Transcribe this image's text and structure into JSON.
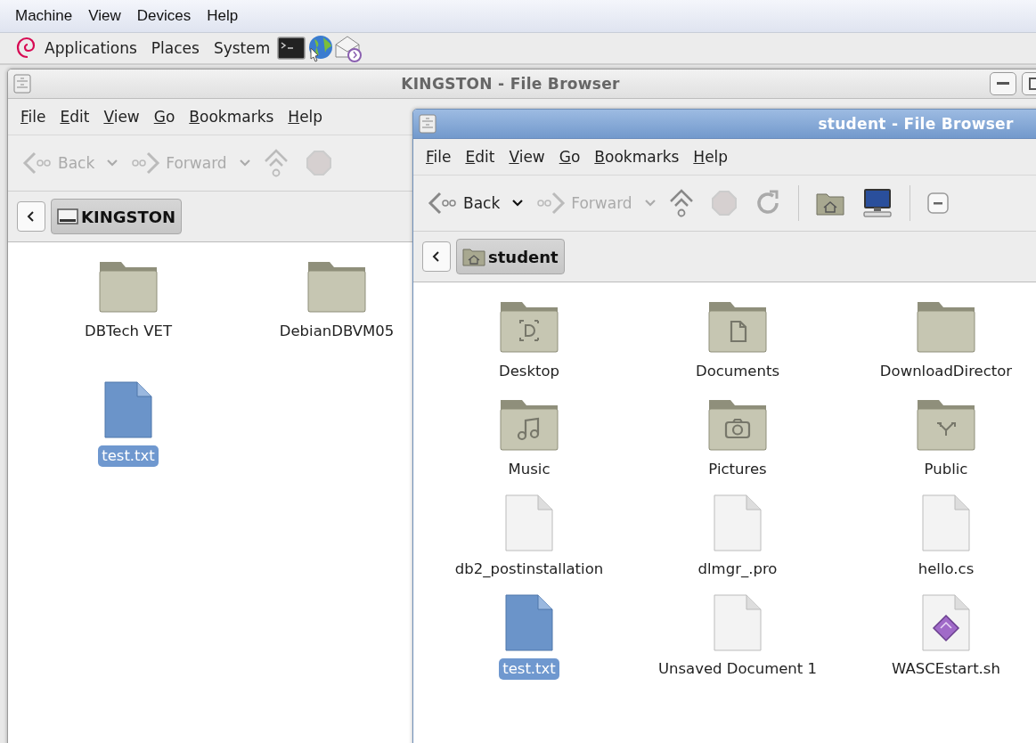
{
  "vm_menu": [
    {
      "label": "Machine"
    },
    {
      "label": "View"
    },
    {
      "label": "Devices"
    },
    {
      "label": "Help"
    }
  ],
  "panel": {
    "menus": [
      {
        "label": "Applications"
      },
      {
        "label": "Places"
      },
      {
        "label": "System"
      }
    ]
  },
  "windows": [
    {
      "title": "KINGSTON - File Browser",
      "active": false,
      "menu": [
        {
          "label": "File"
        },
        {
          "label": "Edit"
        },
        {
          "label": "View"
        },
        {
          "label": "Go"
        },
        {
          "label": "Bookmarks"
        },
        {
          "label": "Help"
        }
      ],
      "toolbar": [
        {
          "kind": "back",
          "label": "Back",
          "disabled": true
        },
        {
          "kind": "forward",
          "label": "Forward",
          "disabled": true
        },
        {
          "kind": "up",
          "disabled": true
        },
        {
          "kind": "stop",
          "disabled": true
        }
      ],
      "location": {
        "kind": "drive",
        "label": "KINGSTON"
      },
      "items": [
        {
          "name": "DBTech VET",
          "kind": "folder",
          "selected": false
        },
        {
          "name": "DebianDBVM05",
          "kind": "folder",
          "selected": false
        },
        {
          "name": "test.txt",
          "kind": "text",
          "selected": true
        }
      ]
    },
    {
      "title": "student - File Browser",
      "active": true,
      "menu": [
        {
          "label": "File"
        },
        {
          "label": "Edit"
        },
        {
          "label": "View"
        },
        {
          "label": "Go"
        },
        {
          "label": "Bookmarks"
        },
        {
          "label": "Help"
        }
      ],
      "toolbar": [
        {
          "kind": "back",
          "label": "Back",
          "disabled": false
        },
        {
          "kind": "forward",
          "label": "Forward",
          "disabled": true
        },
        {
          "kind": "up",
          "disabled": false
        },
        {
          "kind": "stop",
          "disabled": true
        },
        {
          "kind": "reload"
        },
        {
          "kind": "separator"
        },
        {
          "kind": "home"
        },
        {
          "kind": "computer"
        },
        {
          "kind": "separator"
        },
        {
          "kind": "zoom"
        }
      ],
      "location": {
        "kind": "home",
        "label": "student"
      },
      "items": [
        {
          "name": "Desktop",
          "kind": "desktop",
          "selected": false
        },
        {
          "name": "Documents",
          "kind": "documents",
          "selected": false
        },
        {
          "name": "DownloadDirector",
          "kind": "folder",
          "selected": false
        },
        {
          "name": "Music",
          "kind": "music",
          "selected": false
        },
        {
          "name": "Pictures",
          "kind": "pictures",
          "selected": false
        },
        {
          "name": "Public",
          "kind": "public",
          "selected": false
        },
        {
          "name": "db2_postinstallation",
          "kind": "file",
          "selected": false
        },
        {
          "name": "dlmgr_.pro",
          "kind": "file",
          "selected": false
        },
        {
          "name": "hello.cs",
          "kind": "file",
          "selected": false
        },
        {
          "name": "test.txt",
          "kind": "text",
          "selected": true
        },
        {
          "name": "Unsaved Document 1",
          "kind": "file",
          "selected": false
        },
        {
          "name": "WASCEstart.sh",
          "kind": "script",
          "selected": false
        }
      ]
    }
  ]
}
